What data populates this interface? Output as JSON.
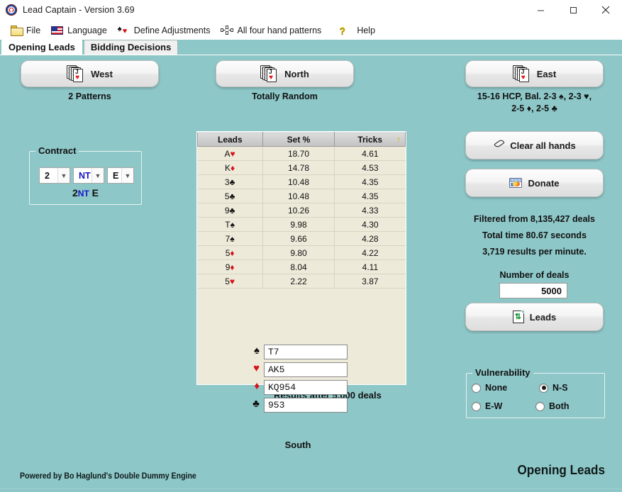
{
  "window": {
    "title": "Lead Captain - Version 3.69",
    "app_icon": "shield-icon",
    "minimize": "minimize-icon",
    "maximize": "maximize-icon",
    "close": "close-icon"
  },
  "menu": {
    "items": [
      {
        "label": "File",
        "icon": "folder-icon"
      },
      {
        "label": "Language",
        "icon": "us-flag-icon"
      },
      {
        "label": "Define Adjustments",
        "icon": "spade-heart-icon"
      },
      {
        "label": "All four hand patterns",
        "icon": "hierarchy-icon"
      },
      {
        "label": "Help",
        "icon": "question-mark-icon"
      }
    ]
  },
  "tabs": [
    {
      "label": "Opening Leads",
      "active": true
    },
    {
      "label": "Bidding Decisions",
      "active": false
    }
  ],
  "hands": {
    "west": {
      "button": "West",
      "caption": "2 Patterns"
    },
    "north": {
      "button": "North",
      "caption": "Totally Random"
    },
    "east": {
      "button": "East",
      "caption_line1": "15-16 HCP, Bal. 2-3 ♠, 2-3 ♥,",
      "caption_line2": "2-5 ♦, 2-5 ♣"
    }
  },
  "contract": {
    "legend": "Contract",
    "level": "2",
    "denomination": "NT",
    "declarer": "E",
    "summary_level": "2",
    "summary_denom": "NT",
    "summary_declarer": "E"
  },
  "chart_data": {
    "type": "table",
    "title": "Results after 5,000 deals",
    "columns": [
      "Leads",
      "Set %",
      "Tricks"
    ],
    "sorted_by": "Tricks",
    "sort_direction": "ascending-indicator",
    "rows": [
      {
        "lead_rank": "A",
        "lead_suit": "♥",
        "suit_color": "red",
        "set_pct": "18.70",
        "tricks": "4.61"
      },
      {
        "lead_rank": "K",
        "lead_suit": "♦",
        "suit_color": "red",
        "set_pct": "14.78",
        "tricks": "4.53"
      },
      {
        "lead_rank": "3",
        "lead_suit": "♣",
        "suit_color": "black",
        "set_pct": "10.48",
        "tricks": "4.35"
      },
      {
        "lead_rank": "5",
        "lead_suit": "♣",
        "suit_color": "black",
        "set_pct": "10.48",
        "tricks": "4.35"
      },
      {
        "lead_rank": "9",
        "lead_suit": "♣",
        "suit_color": "black",
        "set_pct": "10.26",
        "tricks": "4.33"
      },
      {
        "lead_rank": "T",
        "lead_suit": "♠",
        "suit_color": "black",
        "set_pct": "9.98",
        "tricks": "4.30"
      },
      {
        "lead_rank": "7",
        "lead_suit": "♠",
        "suit_color": "black",
        "set_pct": "9.66",
        "tricks": "4.28"
      },
      {
        "lead_rank": "5",
        "lead_suit": "♦",
        "suit_color": "red",
        "set_pct": "9.80",
        "tricks": "4.22"
      },
      {
        "lead_rank": "9",
        "lead_suit": "♦",
        "suit_color": "red",
        "set_pct": "8.04",
        "tricks": "4.11"
      },
      {
        "lead_rank": "5",
        "lead_suit": "♥",
        "suit_color": "red",
        "set_pct": "2.22",
        "tricks": "3.87"
      }
    ]
  },
  "actions": {
    "clear_all_hands": "Clear all hands",
    "donate": "Donate",
    "leads": "Leads"
  },
  "stats": {
    "filtered": "Filtered from 8,135,427 deals",
    "total_time": "Total time 80.67 seconds",
    "rate": "3,719 results per minute."
  },
  "deals": {
    "label": "Number of deals",
    "value": "5000"
  },
  "south": {
    "label": "South",
    "rows": [
      {
        "suit": "♠",
        "color": "black",
        "cards": "T7"
      },
      {
        "suit": "♥",
        "color": "red",
        "cards": "AK5"
      },
      {
        "suit": "♦",
        "color": "red",
        "cards": "KQ954"
      },
      {
        "suit": "♣",
        "color": "black",
        "cards": "953"
      }
    ]
  },
  "vulnerability": {
    "legend": "Vulnerability",
    "options": [
      {
        "label": "None",
        "selected": false
      },
      {
        "label": "N-S",
        "selected": true
      },
      {
        "label": "E-W",
        "selected": false
      },
      {
        "label": "Both",
        "selected": false
      }
    ]
  },
  "footer": {
    "left": "Powered by Bo Haglund's  Double Dummy Engine",
    "right": "Opening Leads"
  },
  "colors": {
    "background": "#8ec7c8",
    "table_cell": "#eeeada",
    "table_header": "#c8c8c8",
    "red_suit": "#d81414",
    "nt_blue": "#1515c8"
  }
}
